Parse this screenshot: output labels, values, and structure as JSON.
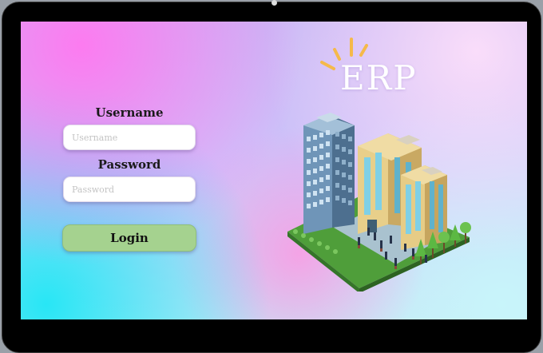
{
  "app": {
    "brand": "ERP"
  },
  "login_form": {
    "username_label": "Username",
    "username_placeholder": "Username",
    "password_label": "Password",
    "password_placeholder": "Password",
    "login_label": "Login"
  },
  "colors": {
    "login_button": "#a5d28f",
    "bezel": "#000000",
    "title": "#ffffff",
    "accent_rays": "#f5b94a"
  },
  "icons": {
    "rays": "sparkle-rays-icon",
    "illustration": "city-buildings-illustration"
  }
}
